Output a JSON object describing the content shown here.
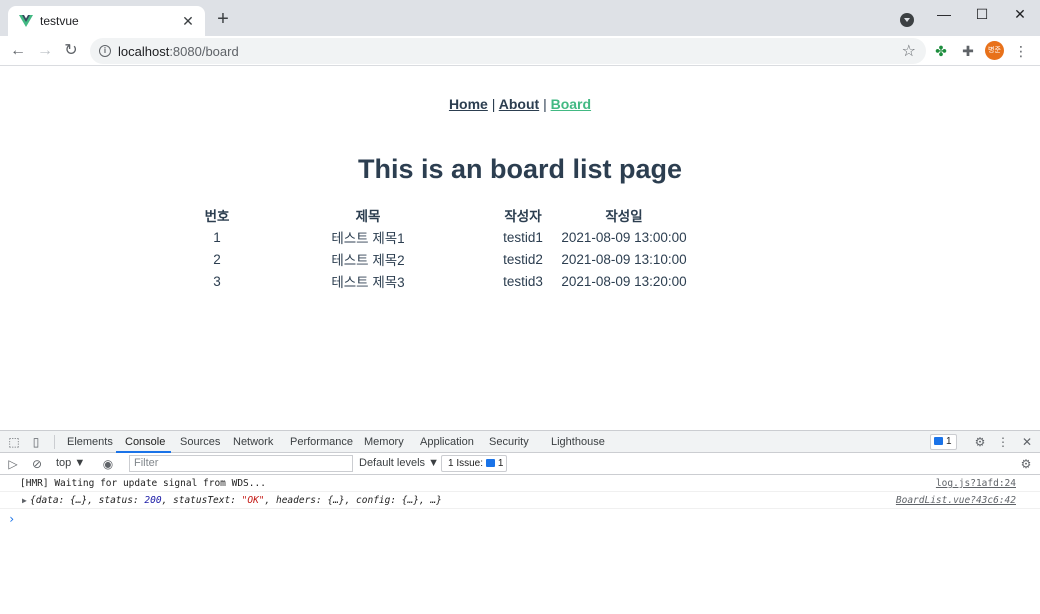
{
  "browser": {
    "tab_title": "testvue",
    "tab_close": "✕",
    "new_tab": "+",
    "url_host": "localhost",
    "url_rest": ":8080/board",
    "avatar_text": "병준",
    "window_buttons": [
      "—",
      "☐",
      "✕"
    ]
  },
  "nav": {
    "home": "Home",
    "about": "About",
    "board": "Board",
    "separator": "|"
  },
  "page": {
    "title": "This is an board list page"
  },
  "table": {
    "headers": [
      "번호",
      "제목",
      "작성자",
      "작성일"
    ],
    "rows": [
      [
        "1",
        "테스트 제목1",
        "testid1",
        "2021-08-09 13:00:00"
      ],
      [
        "2",
        "테스트 제목2",
        "testid2",
        "2021-08-09 13:10:00"
      ],
      [
        "3",
        "테스트 제목3",
        "testid3",
        "2021-08-09 13:20:00"
      ]
    ]
  },
  "devtools": {
    "tabs": [
      "Elements",
      "Console",
      "Sources",
      "Network",
      "Performance",
      "Memory",
      "Application",
      "Security",
      "Lighthouse"
    ],
    "active_tab": "Console",
    "issues_count": "1",
    "context": "top ▼",
    "filter_placeholder": "Filter",
    "levels": "Default levels ▼",
    "issue_chip": "1 Issue:",
    "issue_chip_count": "1",
    "logs": [
      {
        "text": "[HMR] Waiting for update signal from WDS...",
        "source": "log.js?1afd:24"
      },
      {
        "source": "BoardList.vue?43c6:42"
      }
    ],
    "object_log": {
      "open": "{data: {…}, status: ",
      "status": "200",
      "mid": ", statusText: ",
      "status_text": "\"OK\"",
      "end": ", headers: {…}, config: {…}, …}"
    },
    "prompt": "›"
  },
  "colors": {
    "accent": "#42b983",
    "text": "#2c3e50",
    "devtools_blue": "#1a73e8"
  }
}
